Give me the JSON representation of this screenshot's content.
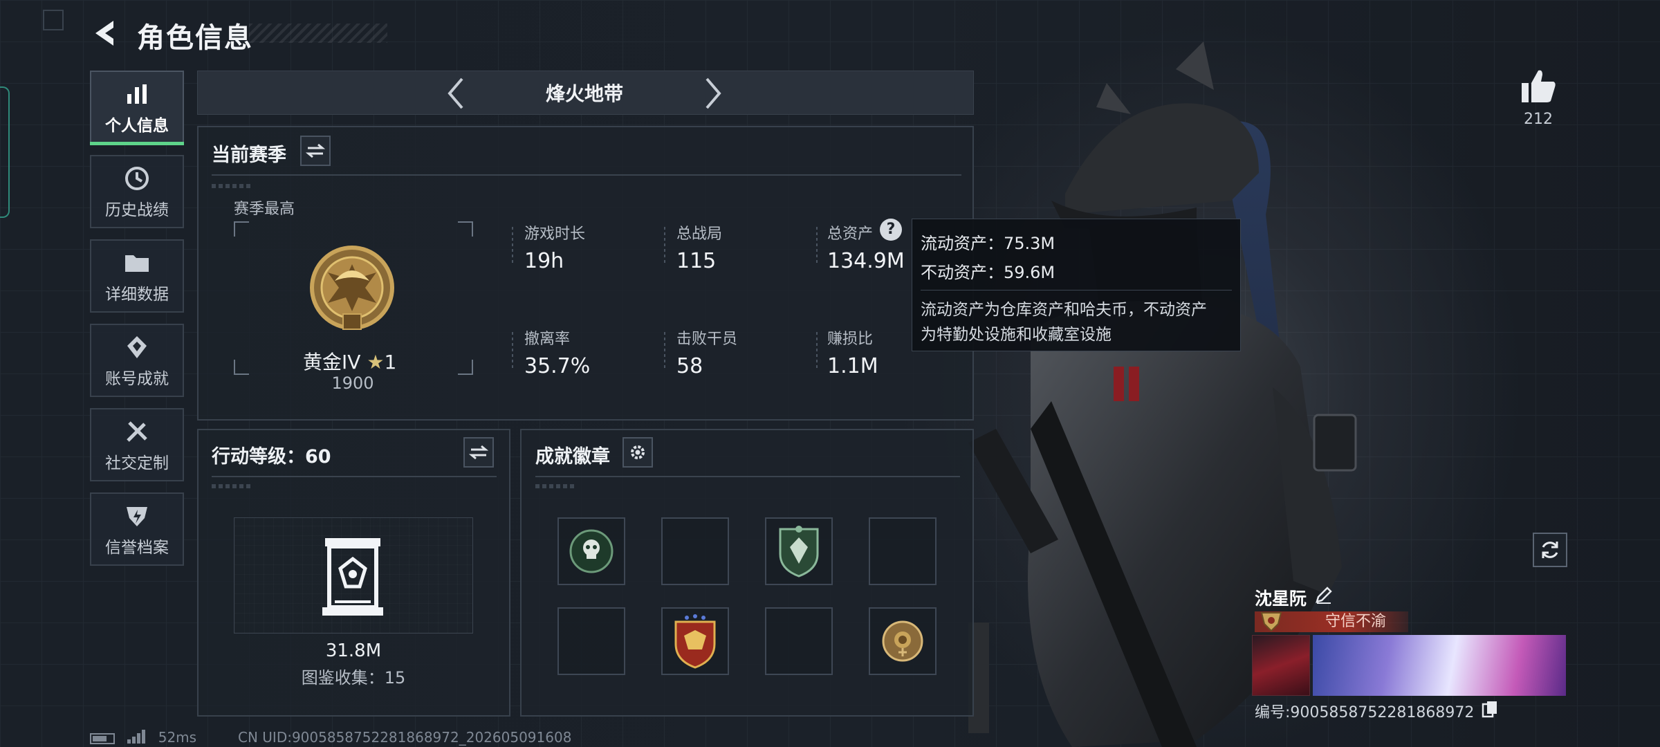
{
  "header": {
    "title": "角色信息",
    "back_icon": "back-arrow-icon"
  },
  "sidebar": {
    "items": [
      {
        "label": "个人信息",
        "icon": "bar-chart-icon",
        "active": true
      },
      {
        "label": "历史战绩",
        "icon": "history-clock-icon",
        "active": false
      },
      {
        "label": "详细数据",
        "icon": "folder-icon",
        "active": false
      },
      {
        "label": "账号成就",
        "icon": "achievement-icon",
        "active": false
      },
      {
        "label": "社交定制",
        "icon": "tools-icon",
        "active": false
      },
      {
        "label": "信誉档案",
        "icon": "credit-shield-icon",
        "active": false
      }
    ]
  },
  "mode": {
    "label": "烽火地带"
  },
  "season": {
    "title": "当前赛季",
    "best_label": "赛季最高",
    "rank_name": "黄金IV",
    "rank_stars": "1",
    "rank_score": "1900",
    "stats": [
      {
        "label": "游戏时长",
        "value": "19h"
      },
      {
        "label": "总战局",
        "value": "115"
      },
      {
        "label": "总资产",
        "value": "134.9M"
      },
      {
        "label": "撤离率",
        "value": "35.7%"
      },
      {
        "label": "击败干员",
        "value": "58"
      },
      {
        "label": "赚损比",
        "value": "1.1M"
      }
    ]
  },
  "tooltip": {
    "liquid": "流动资产：75.3M",
    "fixed": "不动资产：59.6M",
    "desc_1": "流动资产为仓库资产和哈夫币，不动资产",
    "desc_2": "为特勤处设施和收藏室设施"
  },
  "action_level": {
    "title": "行动等级：60",
    "value": "31.8M",
    "collection": "图鉴收集：15"
  },
  "badges": {
    "title": "成就徽章",
    "slots": [
      "skull-badge-icon",
      "",
      "shield-badge-icon",
      "",
      "",
      "winged-shield-badge-icon",
      "",
      "rose-coin-badge-icon"
    ]
  },
  "right": {
    "like_count": "212",
    "player_name": "沈星阮",
    "player_title": "守信不渝",
    "uid_line": "编号:9005858752281868972"
  },
  "footer": {
    "ping": "52ms",
    "cn_uid": "CN UID:9005858752281868972_202605091608"
  },
  "colors": {
    "accent_green": "#5ed48a",
    "panel_border": "#38414c",
    "title_red": "#9c2f24"
  }
}
